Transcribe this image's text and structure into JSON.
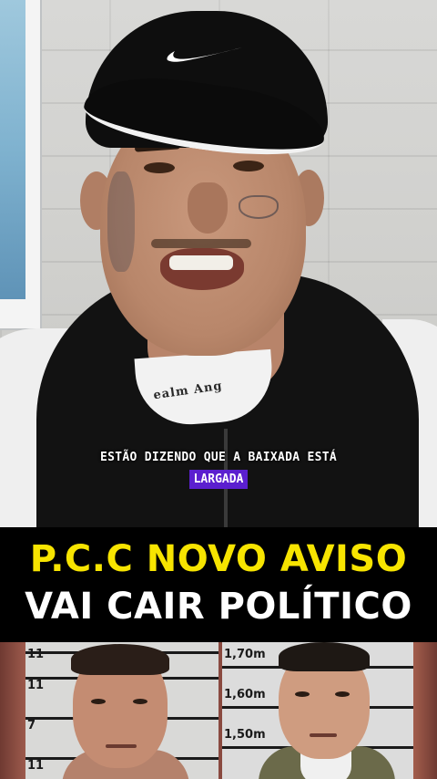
{
  "video": {
    "caption_line1": "ESTÃO DIZENDO QUE A BAIXADA ESTÁ",
    "caption_highlight": "LARGADA",
    "caption_highlight_color": "#5b1fcf",
    "collar_print": "ealm Ang"
  },
  "banner": {
    "headline_1": "P.C.C NOVO AVISO",
    "headline_1_color": "#f7e400",
    "headline_2": "VAI CAIR POLÍTICO",
    "headline_2_color": "#ffffff"
  },
  "mugshots": {
    "left_height_labels": [
      "11",
      "11",
      "7",
      "11"
    ],
    "right_height_labels": [
      "1,70m",
      "1,60m",
      "1,50m"
    ]
  },
  "icons": {
    "cap_logo": "swoosh-icon"
  }
}
